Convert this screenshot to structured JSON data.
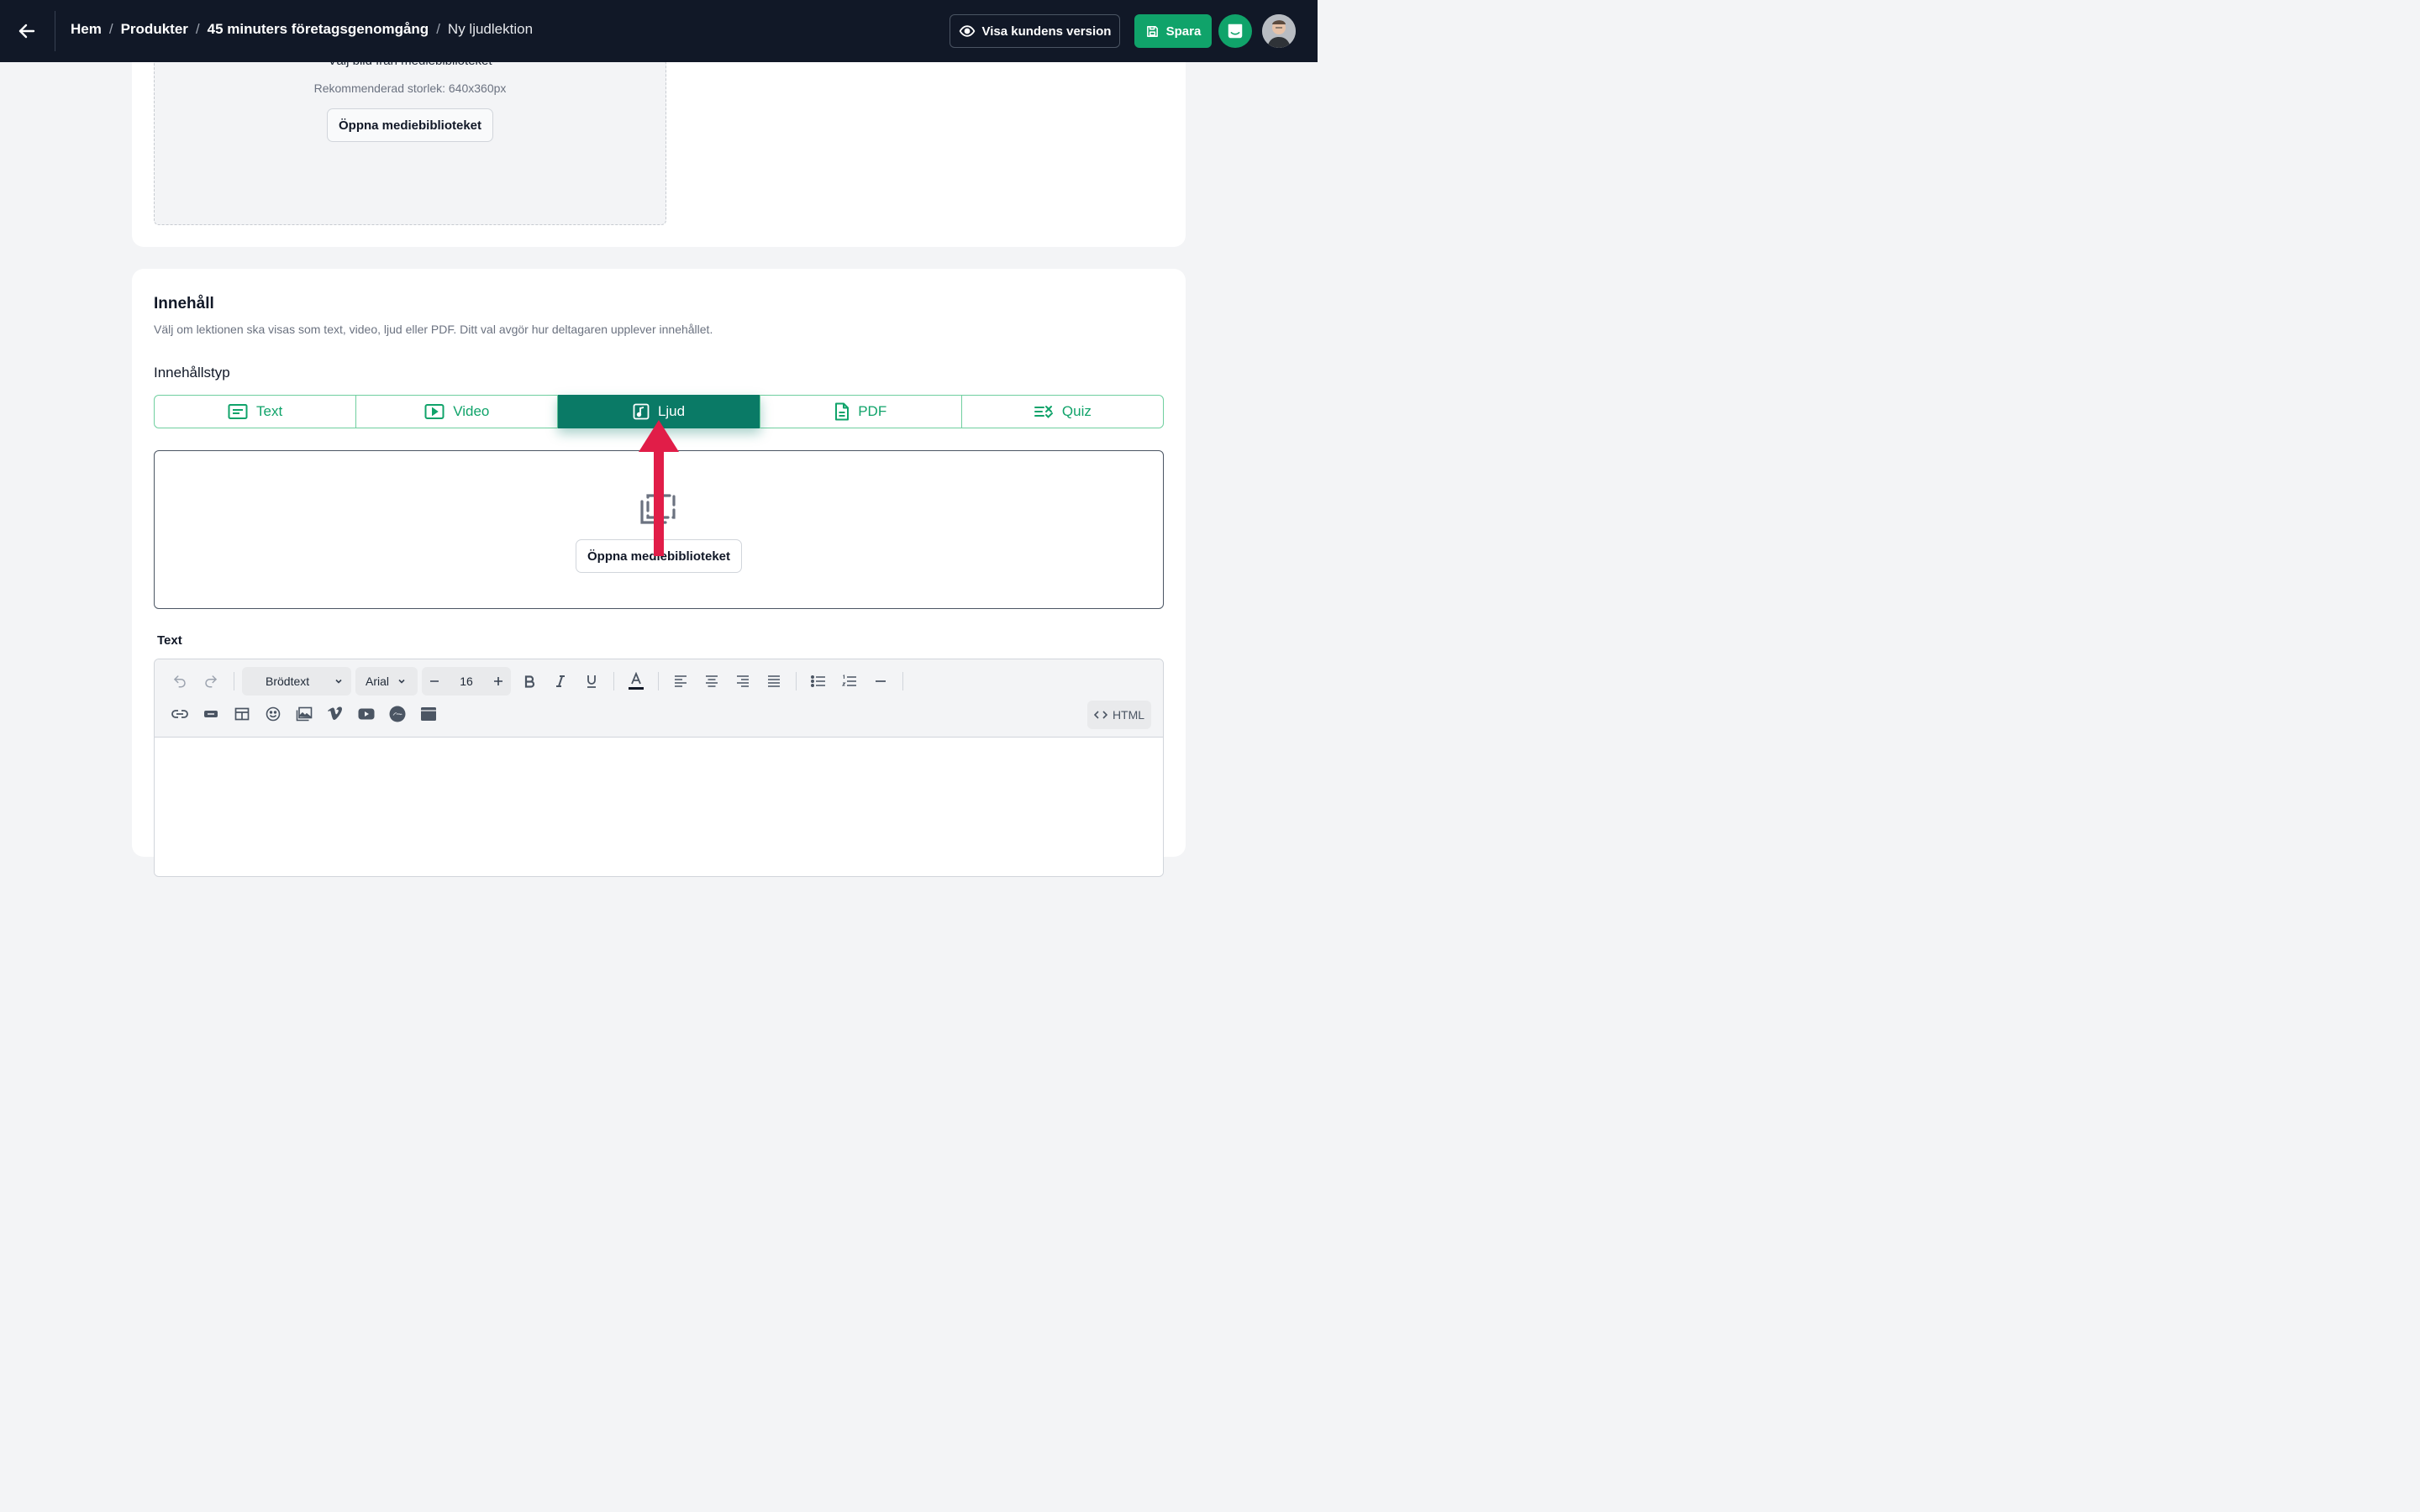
{
  "header": {
    "breadcrumb": [
      "Hem",
      "Produkter",
      "45 minuters företagsgenomgång"
    ],
    "current": "Ny ljudlektion",
    "separator": "/",
    "preview_label": "Visa kundens version",
    "save_label": "Spara"
  },
  "image_section": {
    "title": "Välj bild från mediebiblioteket",
    "hint": "Rekommenderad storlek: 640x360px",
    "button": "Öppna mediebiblioteket"
  },
  "content": {
    "title": "Innehåll",
    "description": "Välj om lektionen ska visas som text, video, ljud eller PDF. Ditt val avgör hur deltagaren upplever innehållet.",
    "type_label": "Innehållstyp",
    "types": [
      {
        "label": "Text",
        "icon": "text-icon"
      },
      {
        "label": "Video",
        "icon": "video-icon"
      },
      {
        "label": "Ljud",
        "icon": "audio-icon",
        "active": true
      },
      {
        "label": "PDF",
        "icon": "pdf-icon"
      },
      {
        "label": "Quiz",
        "icon": "quiz-icon"
      }
    ],
    "media_button": "Öppna mediebiblioteket"
  },
  "editor": {
    "label": "Text",
    "block_format": "Brödtext",
    "font": "Arial",
    "font_size": "16",
    "html_label": "HTML"
  },
  "colors": {
    "topbar": "#111827",
    "brand_green": "#10a36a",
    "active_tab": "#0a7a66",
    "annotation_arrow": "#e11d48"
  }
}
